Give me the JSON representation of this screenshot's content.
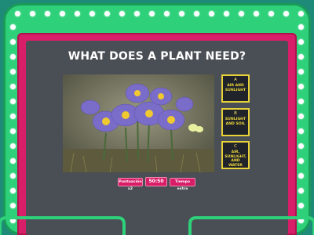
{
  "game": {
    "question": "WHAT DOES A PLANT NEED?",
    "answers": [
      {
        "letter": "A",
        "text": "AIR AND SUNLIGHT"
      },
      {
        "letter": "B",
        "text": "SUNLIGHT AND SOIL"
      },
      {
        "letter": "C",
        "text": "AIR, SUNLIGHT, AND WATER"
      }
    ],
    "bonus_label": "Puntuación x2",
    "timer": "50:50",
    "extra_time_label": "Tiempo extra"
  },
  "colors": {
    "frame_green": "#2ed07a",
    "board_pink": "#d81e68",
    "screen_gray": "#4a4e55",
    "answer_border": "#e8d23a"
  }
}
